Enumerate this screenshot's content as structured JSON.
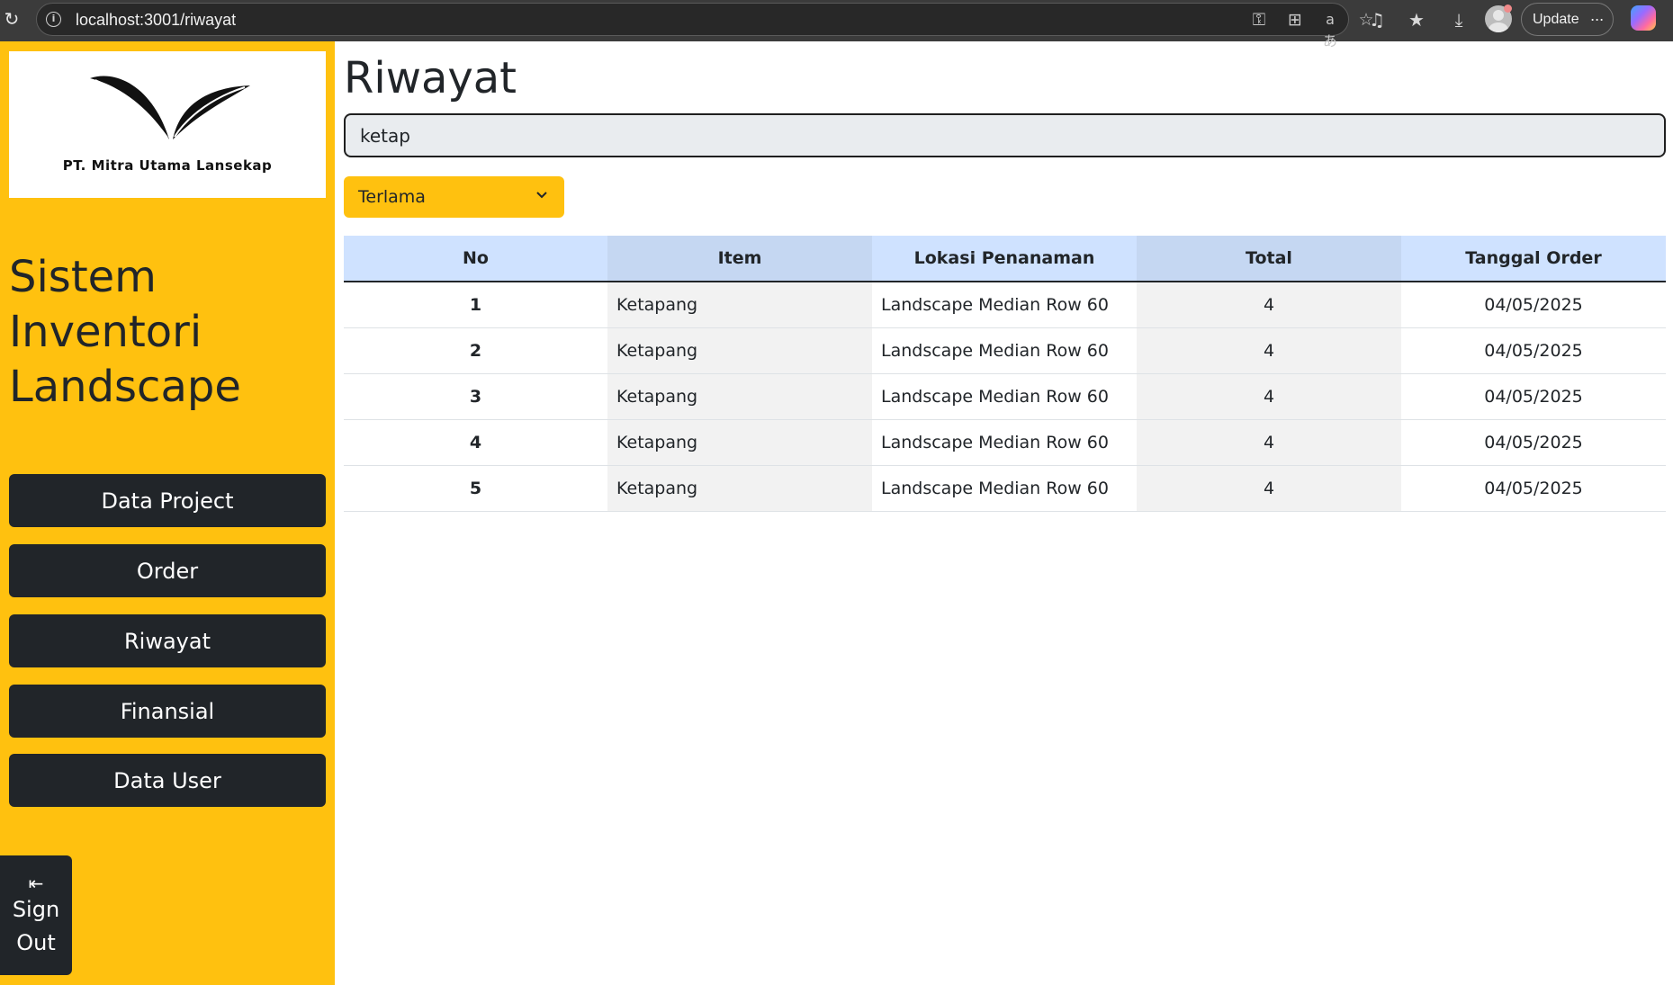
{
  "browser": {
    "url": "localhost:3001/riwayat",
    "update_label": "Update",
    "more_label": "···"
  },
  "sidebar": {
    "logo_text": "PT. Mitra Utama Lansekap",
    "app_title_lines": [
      "Sistem",
      "Inventori",
      "Landscape"
    ],
    "nav": [
      {
        "label": "Data Project"
      },
      {
        "label": "Order"
      },
      {
        "label": "Riwayat"
      },
      {
        "label": "Finansial"
      },
      {
        "label": "Data User"
      }
    ],
    "signout_lines": [
      "Sign",
      "Out"
    ]
  },
  "main": {
    "title": "Riwayat",
    "search_value": "ketap",
    "sort_selected": "Terlama",
    "table": {
      "headers": [
        "No",
        "Item",
        "Lokasi Penanaman",
        "Total",
        "Tanggal Order"
      ],
      "rows": [
        [
          "1",
          "Ketapang",
          "Landscape Median Row 60",
          "4",
          "04/05/2025"
        ],
        [
          "2",
          "Ketapang",
          "Landscape Median Row 60",
          "4",
          "04/05/2025"
        ],
        [
          "3",
          "Ketapang",
          "Landscape Median Row 60",
          "4",
          "04/05/2025"
        ],
        [
          "4",
          "Ketapang",
          "Landscape Median Row 60",
          "4",
          "04/05/2025"
        ],
        [
          "5",
          "Ketapang",
          "Landscape Median Row 60",
          "4",
          "04/05/2025"
        ]
      ]
    }
  },
  "colors": {
    "sidebar_bg": "#ffc10f",
    "dark_button": "#212529",
    "table_header": "#cfe2ff"
  }
}
